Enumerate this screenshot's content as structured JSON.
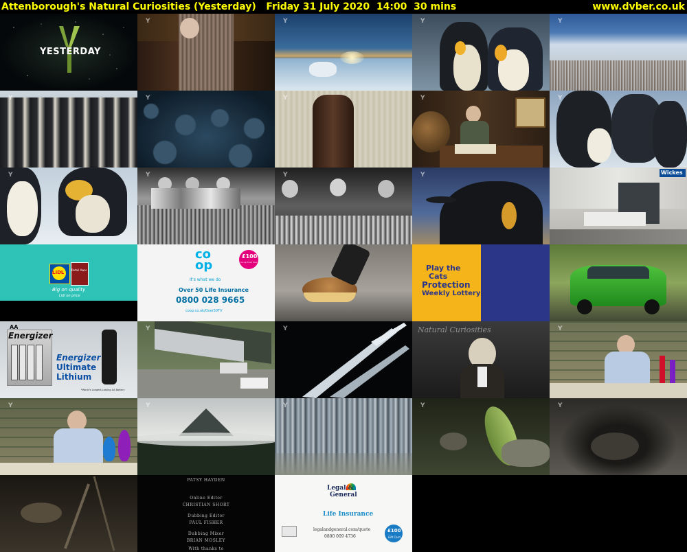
{
  "header": {
    "title": "Attenborough's Natural Curiosities (Yesterday)   Friday 31 July 2020  14:00  30 mins",
    "site": "www.dvber.co.uk"
  },
  "colors": {
    "header_bg": "#000000",
    "header_text": "#ffff00"
  },
  "thumbs": {
    "yesterday_logo_text": "YESTERDAY",
    "channel_bug": "Y",
    "wickes": "Wickes",
    "lidl_logo": "LIDL",
    "lidl_badge": "Retail Awards",
    "lidl_tagline": "Big on quality",
    "lidl_tagline2": "Lidl on price",
    "coop_logo_top": "co",
    "coop_logo_bottom": "op",
    "coop_sub": "It's what we do",
    "coop_badge": "£100",
    "coop_badge_sub": "Co-op Food Voucher",
    "coop_product": "Over 50 Life Insurance",
    "coop_phone": "0800 028 9665",
    "coop_url": "coop.co.uk/Over50TV",
    "cats_line1": "Play the",
    "cats_line2": "Cats",
    "cats_line3": "Protection",
    "cats_line4": "Weekly Lottery",
    "energizer_brand": "Energizer",
    "energizer_line1": "Energizer",
    "energizer_line2": "Ultimate",
    "energizer_line3": "Lithium",
    "energizer_aa": "AA",
    "energizer_claim": "*World's Longest-Lasting AA Battery",
    "curiosities_text": "Natural Curiosities",
    "credits": [
      "PATSY HAYDEN",
      "Online Editor",
      "CHRISTIAN SHORT",
      "Dubbing Editor",
      "PAUL FISHER",
      "Dubbing Mixer",
      "BRIAN MOSLEY",
      "With thanks to"
    ],
    "lg_brand_1": "Legal &",
    "lg_brand_2": "General",
    "lg_product": "Life Insurance",
    "lg_url": "legalandgeneral.com/quote",
    "lg_phone": "0800 009 4736",
    "lg_badge": "£100",
    "lg_badge_sub": "Gift Card"
  }
}
